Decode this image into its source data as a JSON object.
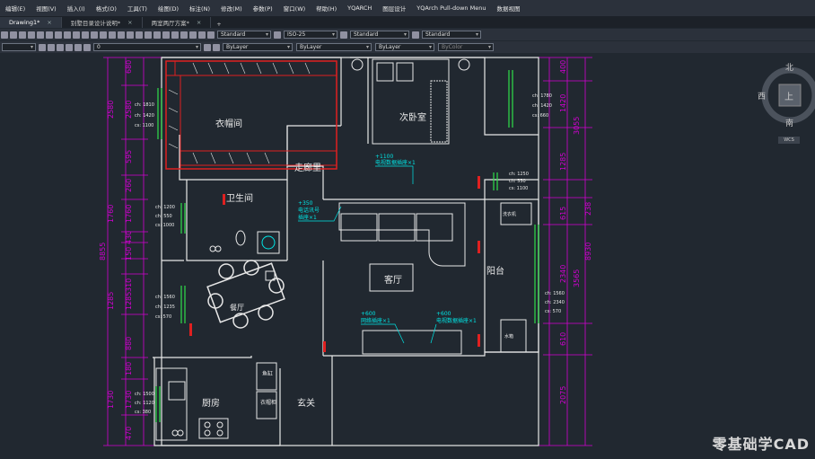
{
  "menu": [
    "编辑(E)",
    "视图(V)",
    "插入(I)",
    "格式(O)",
    "工具(T)",
    "绘图(D)",
    "标注(N)",
    "修改(M)",
    "参数(P)",
    "窗口(W)",
    "帮助(H)",
    "YQARCH",
    "图层设计",
    "YQArch Pull-down Menu",
    "数据视图"
  ],
  "tabs": [
    {
      "label": "Drawing1*",
      "active": true
    },
    {
      "label": "别墅目录设计说明*",
      "active": false
    },
    {
      "label": "两室两厅方案*",
      "active": false
    }
  ],
  "toolbar": {
    "text_style": "Standard",
    "dim_style": "ISO-25",
    "table_style": "Standard",
    "mleader_style": "Standard",
    "layer": "0",
    "color": "ByLayer",
    "linetype": "ByLayer",
    "lineweight": "ByLayer",
    "plot_style": "ByColor"
  },
  "compass": {
    "north": "北",
    "south": "南",
    "west": "西",
    "top": "上",
    "wcs": "WCS"
  },
  "rooms": {
    "closet": "衣帽间",
    "second_bedroom": "次卧室",
    "corridor": "走廊里",
    "bathroom": "卫生间",
    "living": "客厅",
    "balcony": "阳台",
    "dining": "餐厅",
    "kitchen": "厨房",
    "entrance": "玄关",
    "fish": "鱼缸",
    "shoe": "衣帽柜",
    "washer": "洗衣机",
    "water": "水箱"
  },
  "notes": {
    "tv1_h": "+1100",
    "tv1": "电视数据插座×1",
    "tel_h": "+350",
    "tel": "电话讯号",
    "tel2": "插座×1",
    "s1_h": "+600",
    "s1": "网络插座×1",
    "s2_h": "+600",
    "s2": "电视数据插座×1"
  },
  "win_labels": {
    "w1": [
      "ch: 1810",
      "ch: 1420",
      "cs: 1100"
    ],
    "w2": [
      "ch: 1780",
      "ch: 1420",
      "cs: 660"
    ],
    "w3": [
      "ch: 1200",
      "ch: 550",
      "cs: 1000"
    ],
    "w4": [
      "ch: 1250",
      "ch: 550",
      "cs: 1100"
    ],
    "w5": [
      "ch: 1560",
      "ch: 1235",
      "cs: 570"
    ],
    "w6": [
      "ch: 1560",
      "ch: 2340",
      "cs: 570"
    ],
    "w7": [
      "ch: 1500",
      "ch: 1120",
      "cs: 380"
    ]
  },
  "dims_left": [
    "680",
    "2580",
    "595",
    "260",
    "1760",
    "430",
    "150",
    "310",
    "1285",
    "880",
    "180",
    "1730",
    "470"
  ],
  "dims_left_outer": [
    "8855"
  ],
  "dims_right": [
    "400",
    "1420",
    "3055",
    "1285",
    "615",
    "2340",
    "3565",
    "610",
    "2075"
  ],
  "dims_right_outer": [
    "238",
    "8930"
  ],
  "watermark": "零基础学CAD",
  "colors": {
    "bg": "#212830",
    "wall": "#e8e8e8",
    "dim": "#d300d3",
    "window": "#2fe04a",
    "red": "#e02020",
    "cyan": "#00e5e5"
  }
}
